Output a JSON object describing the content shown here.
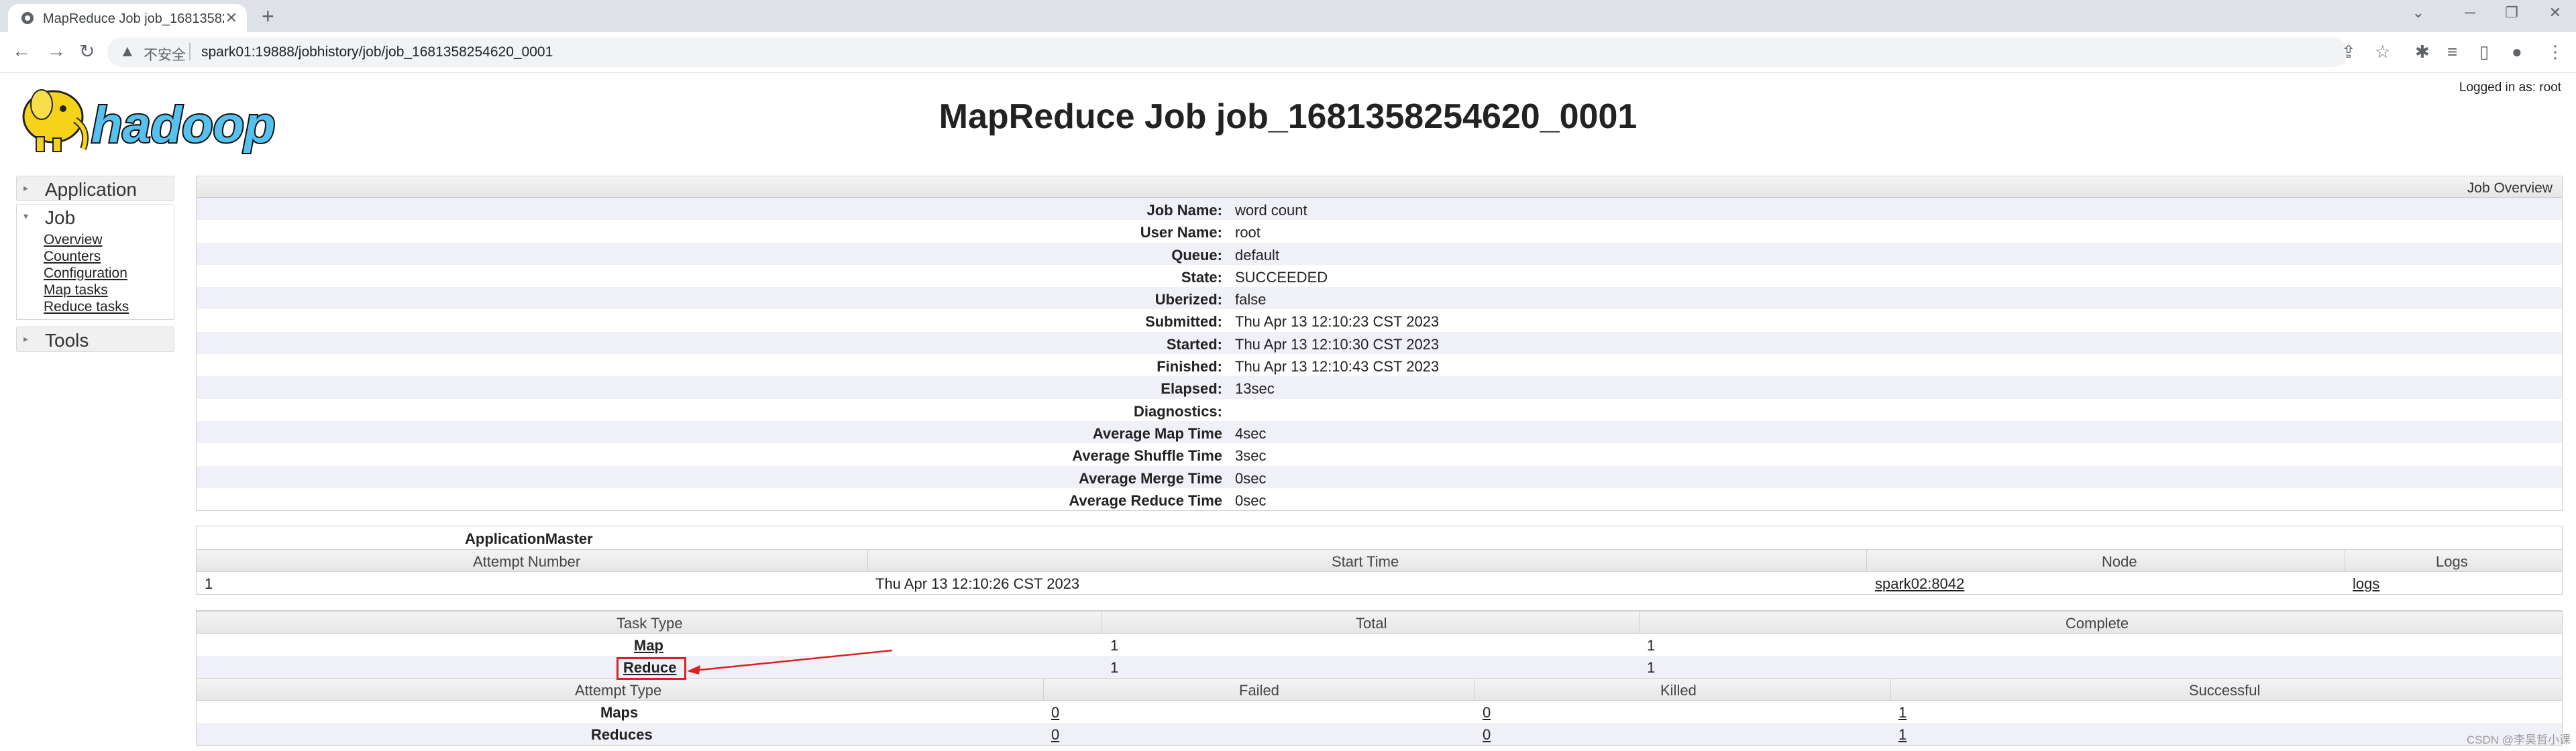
{
  "browser": {
    "tab_title": "MapReduce Job job_16813582…",
    "new_tab_symbol": "+",
    "insecure_label": "不安全",
    "url": "spark01:19888/jobhistory/job/job_1681358254620_0001"
  },
  "page": {
    "title": "MapReduce Job job_1681358254620_0001",
    "logged_in": "Logged in as: root"
  },
  "sidebar": {
    "application": "Application",
    "job": "Job",
    "job_links": [
      "Overview",
      "Counters",
      "Configuration",
      "Map tasks",
      "Reduce tasks"
    ],
    "tools": "Tools"
  },
  "overview": {
    "header": "Job Overview",
    "rows": [
      {
        "label": "Job Name:",
        "value": "word count"
      },
      {
        "label": "User Name:",
        "value": "root"
      },
      {
        "label": "Queue:",
        "value": "default"
      },
      {
        "label": "State:",
        "value": "SUCCEEDED"
      },
      {
        "label": "Uberized:",
        "value": "false"
      },
      {
        "label": "Submitted:",
        "value": "Thu Apr 13 12:10:23 CST 2023"
      },
      {
        "label": "Started:",
        "value": "Thu Apr 13 12:10:30 CST 2023"
      },
      {
        "label": "Finished:",
        "value": "Thu Apr 13 12:10:43 CST 2023"
      },
      {
        "label": "Elapsed:",
        "value": "13sec"
      },
      {
        "label": "Diagnostics:",
        "value": ""
      },
      {
        "label": "Average Map Time",
        "value": "4sec"
      },
      {
        "label": "Average Shuffle Time",
        "value": "3sec"
      },
      {
        "label": "Average Merge Time",
        "value": "0sec"
      },
      {
        "label": "Average Reduce Time",
        "value": "0sec"
      }
    ]
  },
  "am": {
    "title": "ApplicationMaster",
    "headers": [
      "Attempt Number",
      "Start Time",
      "Node",
      "Logs"
    ],
    "row": {
      "attempt": "1",
      "start": "Thu Apr 13 12:10:26 CST 2023",
      "node": "spark02:8042",
      "logs": "logs"
    }
  },
  "tasks": {
    "headers": [
      "Task Type",
      "Total",
      "Complete"
    ],
    "rows": [
      {
        "type": "Map",
        "total": "1",
        "complete": "1"
      },
      {
        "type": "Reduce",
        "total": "1",
        "complete": "1"
      }
    ],
    "attempt_headers": [
      "Attempt Type",
      "Failed",
      "Killed",
      "Successful"
    ],
    "attempt_rows": [
      {
        "type": "Maps",
        "failed": "0",
        "killed": "0",
        "successful": "1"
      },
      {
        "type": "Reduces",
        "failed": "0",
        "killed": "0",
        "successful": "1"
      }
    ]
  },
  "watermark": "CSDN @李昊哲小课",
  "colors": {
    "highlight": "#e02020",
    "row_alt": "#f0f0f8",
    "logo_yellow": "#f6d21b",
    "logo_blue": "#56c1ef"
  }
}
